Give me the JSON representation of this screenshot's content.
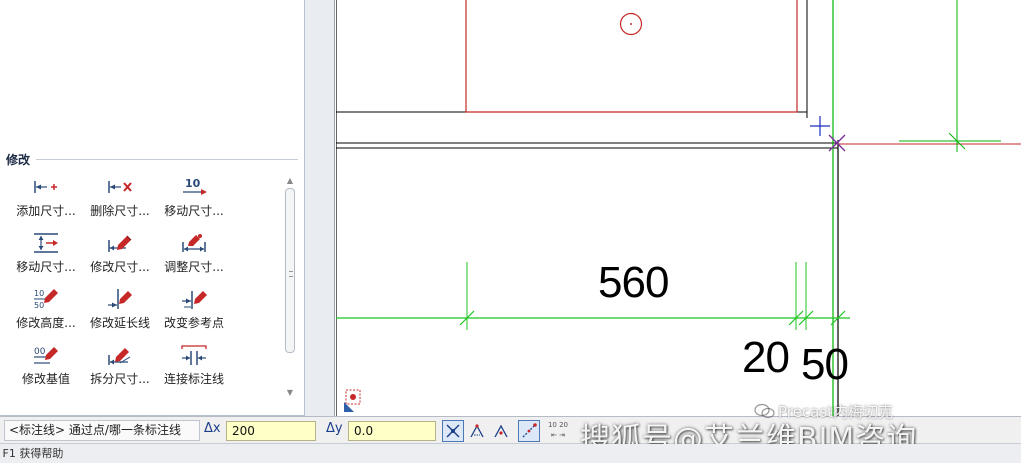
{
  "palette": {
    "section_title": "修改",
    "tools": [
      {
        "id": "add-dimension",
        "label": "添加尺寸...",
        "icon": "add-dimension-point-icon"
      },
      {
        "id": "delete-dimension",
        "label": "删除尺寸...",
        "icon": "delete-dimension-point-icon"
      },
      {
        "id": "move-dimension-text",
        "label": "移动尺寸...",
        "icon": "move-dimension-text-icon",
        "icon_text": "10"
      },
      {
        "id": "move-dimension-line",
        "label": "移动尺寸...",
        "icon": "move-dimension-line-icon"
      },
      {
        "id": "modify-dimension",
        "label": "修改尺寸...",
        "icon": "modify-dimension-pencil-icon"
      },
      {
        "id": "adjust-dimension",
        "label": "调整尺寸...",
        "icon": "adjust-dimension-icon"
      },
      {
        "id": "modify-height",
        "label": "修改高度...",
        "icon": "modify-height-icon",
        "icon_text_top": "10",
        "icon_text_bottom": "50"
      },
      {
        "id": "modify-extension-line",
        "label": "修改延长线",
        "icon": "modify-extension-line-icon"
      },
      {
        "id": "change-reference-point",
        "label": "改变参考点",
        "icon": "change-reference-point-icon"
      },
      {
        "id": "modify-base-value",
        "label": "修改基值",
        "icon": "modify-base-value-icon",
        "icon_text": "00"
      },
      {
        "id": "split-dimension",
        "label": "拆分尺寸...",
        "icon": "split-dimension-icon"
      },
      {
        "id": "join-dimension-line",
        "label": "连接标注线",
        "icon": "join-dimension-line-icon"
      }
    ]
  },
  "canvas": {
    "dimensions": [
      "560",
      "20",
      "50"
    ],
    "colors": {
      "outline": "#000000",
      "wall": "#c62828",
      "dimension_line": "#1fc41f",
      "grid": "#00b400",
      "cursor": "#1a2dbd",
      "crosshair": "#7a2d9a"
    }
  },
  "inputbar": {
    "prompt": "<标注线> 通过点/哪一条标注线",
    "dx_label": "Δx",
    "dx_value": "200",
    "dy_label": "Δy",
    "dy_value": "0.0",
    "stepper_label": "10 20"
  },
  "status": {
    "text": "按 F1 获得帮助"
  },
  "watermark": {
    "text": "搜狐号@艾兰维BIM咨询",
    "account": "Precast内梅切克"
  }
}
